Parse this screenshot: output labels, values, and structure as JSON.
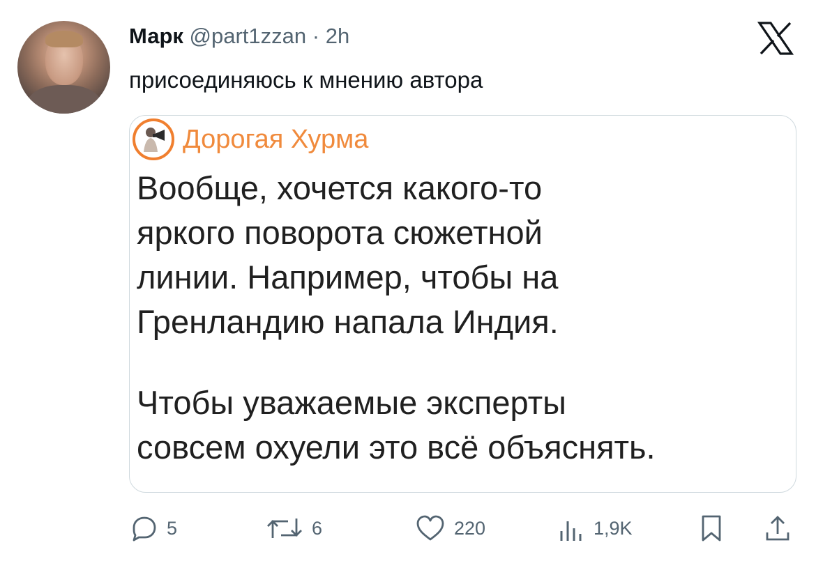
{
  "tweet": {
    "author_name": "Марк",
    "author_handle": "@part1zzan",
    "separator": "·",
    "time": "2h",
    "text": "присоединяюсь к мнению автора"
  },
  "quote": {
    "source_name": "Дорогая Хурма",
    "lines": [
      "Вообще, хочется какого-то",
      "яркого поворота сюжетной",
      "линии. Например, чтобы на",
      "Гренландию напала Индия.",
      "Чтобы уважаемые эксперты",
      "совсем охуели это всё объяснять."
    ]
  },
  "actions": {
    "replies": "5",
    "reposts": "6",
    "likes": "220",
    "views": "1,9K"
  },
  "icons": {
    "brand_logo": "x-logo-icon",
    "reply": "reply-icon",
    "repost": "repost-icon",
    "like": "heart-icon",
    "views": "views-icon",
    "bookmark": "bookmark-icon",
    "share": "share-icon"
  },
  "colors": {
    "text": "#0f1419",
    "secondary": "#536471",
    "border": "#cfd9de",
    "quote_accent": "#f08a3c"
  }
}
